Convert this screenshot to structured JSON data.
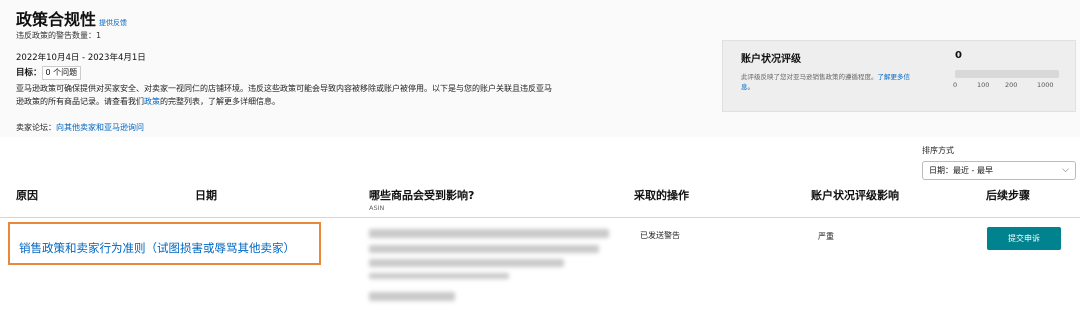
{
  "header": {
    "title": "政策合规性",
    "feedback_link": "提供反馈",
    "warning_count": "违反政策的警告数量：1"
  },
  "summary": {
    "date_range": "2022年10月4日 - 2023年4月1日",
    "goal_label": "目标：",
    "goal_value": "0 个问题",
    "description_part1": "亚马逊政策可确保提供对买家安全、对卖家一视同仁的店铺环境。违反这些政策可能会导致内容被移除或账户被停用。以下是与您的账户关联且违反亚马逊政策的所有商品记录。请查看我们",
    "policy_link": "政策",
    "description_part2": "的完整列表，了解更多详细信息。",
    "forum_label": "卖家论坛：",
    "forum_link": "向其他卖家和亚马逊询问"
  },
  "health_panel": {
    "title": "账户状况评级",
    "description": "此评级反映了您对亚马逊销售政策的遵循程度。",
    "learn_more": "了解更多信息。",
    "score": "0",
    "score_fraction": 0,
    "ticks": [
      "0",
      "100",
      "200",
      "1000"
    ]
  },
  "sort": {
    "label": "排序方式",
    "selected": "日期：最近 - 最早"
  },
  "table": {
    "headers": {
      "reason": "原因",
      "date": "日期",
      "affected": "哪些商品会受到影响?",
      "affected_sub": "ASIN",
      "action": "采取的操作",
      "impact": "账户状况评级影响",
      "next_steps": "后续步骤"
    },
    "rows": [
      {
        "reason": "销售政策和卖家行为准则（试图损害或辱骂其他卖家）",
        "date": "",
        "action": "已发送警告",
        "impact": "严重",
        "next_step_button": "提交申诉"
      }
    ]
  },
  "colors": {
    "link": "#0066c0",
    "button": "#00838f",
    "highlight_border": "#e8883a"
  }
}
